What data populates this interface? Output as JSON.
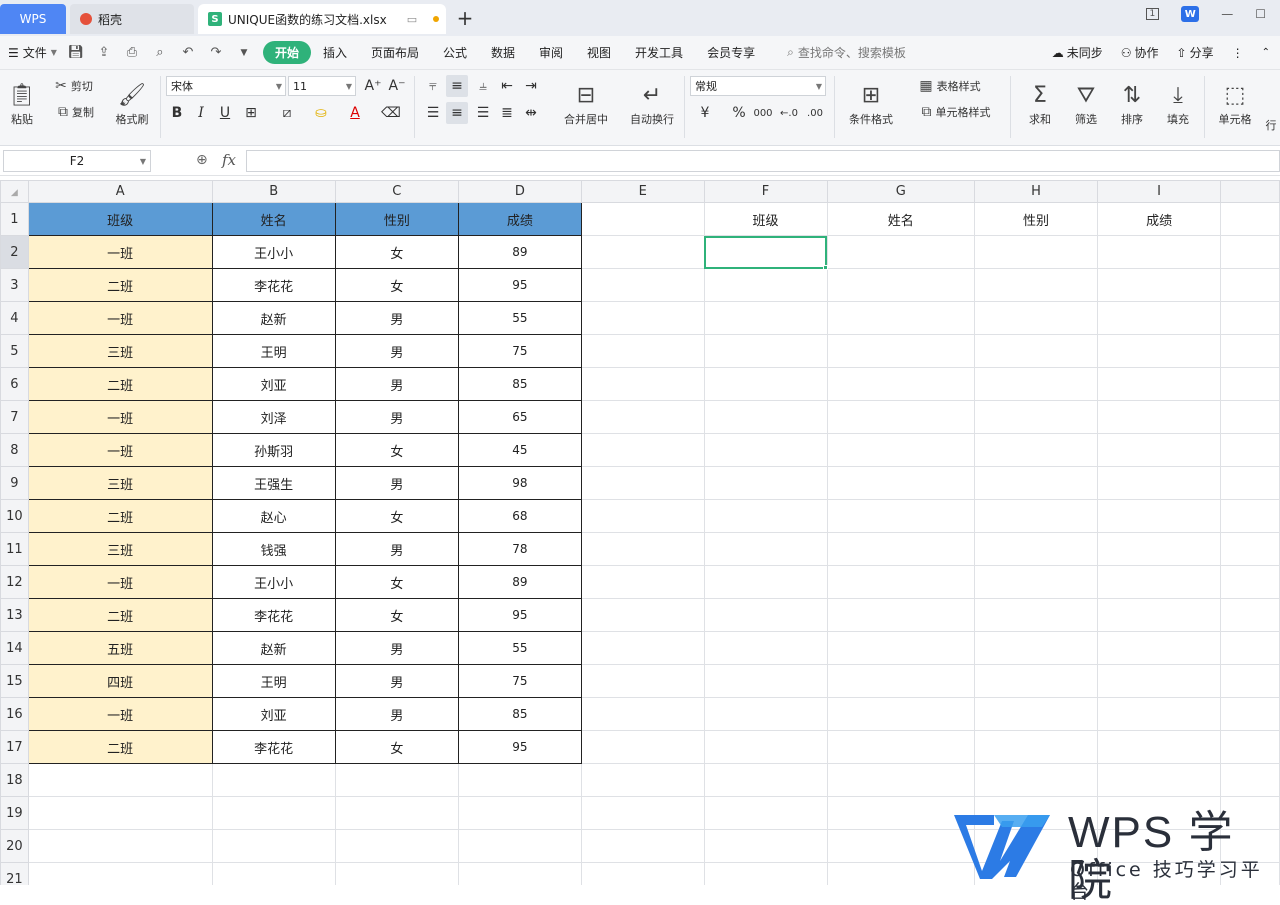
{
  "tabs": {
    "wps": "WPS",
    "daoke": "稻壳",
    "doc": "UNIQUE函数的练习文档.xlsx",
    "add": "+"
  },
  "window": {
    "badge": "1",
    "wps_badge": "W"
  },
  "menubar": {
    "file": "文件",
    "tabs": [
      "开始",
      "插入",
      "页面布局",
      "公式",
      "数据",
      "审阅",
      "视图",
      "开发工具",
      "会员专享"
    ],
    "search": "查找命令、搜索模板",
    "sync": "未同步",
    "collab": "协作",
    "share": "分享"
  },
  "ribbon": {
    "paste": "粘贴",
    "cut": "剪切",
    "copy": "复制",
    "format_painter": "格式刷",
    "font_name": "宋体",
    "font_size": "11",
    "bold": "B",
    "italic": "I",
    "underline": "U",
    "merge_center": "合并居中",
    "wrap": "自动换行",
    "number_format": "常规",
    "currency": "¥",
    "percent": "%",
    "thousands": "000",
    "cond_format": "条件格式",
    "table_style": "表格样式",
    "cell_style": "单元格样式",
    "sum": "求和",
    "filter": "筛选",
    "sort": "排序",
    "fill": "填充",
    "cell": "单元格",
    "more": "行"
  },
  "formula_bar": {
    "name_box": "F2",
    "fx": "fx",
    "formula": ""
  },
  "sheet": {
    "columns": [
      "A",
      "B",
      "C",
      "D",
      "E",
      "F",
      "G",
      "H",
      "I"
    ],
    "selected_column": "F",
    "selected_row": "2",
    "headers": [
      "班级",
      "姓名",
      "性别",
      "成绩"
    ],
    "right_headers": [
      "班级",
      "姓名",
      "性别",
      "成绩"
    ],
    "rows": [
      [
        "一班",
        "王小小",
        "女",
        "89"
      ],
      [
        "二班",
        "李花花",
        "女",
        "95"
      ],
      [
        "一班",
        "赵新",
        "男",
        "55"
      ],
      [
        "三班",
        "王明",
        "男",
        "75"
      ],
      [
        "二班",
        "刘亚",
        "男",
        "85"
      ],
      [
        "一班",
        "刘泽",
        "男",
        "65"
      ],
      [
        "一班",
        "孙斯羽",
        "女",
        "45"
      ],
      [
        "三班",
        "王强生",
        "男",
        "98"
      ],
      [
        "二班",
        "赵心",
        "女",
        "68"
      ],
      [
        "三班",
        "钱强",
        "男",
        "78"
      ],
      [
        "一班",
        "王小小",
        "女",
        "89"
      ],
      [
        "二班",
        "李花花",
        "女",
        "95"
      ],
      [
        "五班",
        "赵新",
        "男",
        "55"
      ],
      [
        "四班",
        "王明",
        "男",
        "75"
      ],
      [
        "一班",
        "刘亚",
        "男",
        "85"
      ],
      [
        "二班",
        "李花花",
        "女",
        "95"
      ]
    ],
    "empty_rows": [
      "18",
      "19",
      "20",
      "21"
    ]
  },
  "watermark": {
    "title": "WPS 学院",
    "subtitle": "Office 技巧学习平台"
  },
  "colors": {
    "header_blue": "#5b9bd5",
    "class_yellow": "#fff2cc",
    "accent_green": "#2fb27a",
    "wps_blue": "#4f86f4"
  }
}
